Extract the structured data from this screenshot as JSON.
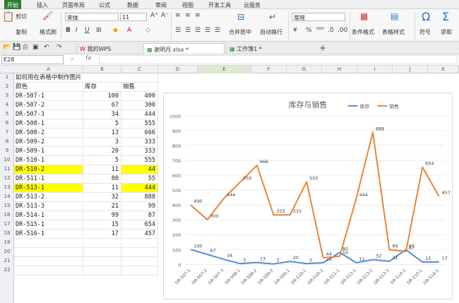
{
  "menu": [
    "开始",
    "插入",
    "页面布局",
    "公式",
    "数据",
    "审阅",
    "视图",
    "开发工具",
    "云服务"
  ],
  "ribbon": {
    "cut": "剪切",
    "copy": "复制",
    "format_painter": "格式刷",
    "font": "宋体",
    "size": "11",
    "merge": "合并居中",
    "wrap": "自动换行",
    "number_format": "常规",
    "cond_format": "条件格式",
    "table_style": "表格样式",
    "symbol": "符号",
    "sum": "求和"
  },
  "tabs": {
    "wps": "我的WPS",
    "file": "谢明月.xlsx *",
    "book": "工作簿1 *"
  },
  "formula_bar": {
    "cell_ref": "E28",
    "fx": "fx",
    "value": ""
  },
  "columns": [
    "A",
    "B",
    "C",
    "D",
    "E",
    "F",
    "G",
    "H",
    "I",
    "J",
    "K"
  ],
  "title_cell": "如何用在表格中制作图片",
  "headers": [
    "颜色",
    "库存",
    "销售"
  ],
  "rows": [
    [
      "DR-507-1",
      "100",
      "400"
    ],
    [
      "DR-507-2",
      "67",
      "300"
    ],
    [
      "DR-507-3",
      "34",
      "444"
    ],
    [
      "DR-508-1",
      "5",
      "555"
    ],
    [
      "DR-508-2",
      "13",
      "666"
    ],
    [
      "DR-509-2",
      "3",
      "333"
    ],
    [
      "DR-509-1",
      "20",
      "333"
    ],
    [
      "DR-510-1",
      "5",
      "555"
    ],
    [
      "DR-510-2",
      "11",
      "44"
    ],
    [
      "DR-511-1",
      "80",
      "55"
    ],
    [
      "DR-513-1",
      "11",
      "444"
    ],
    [
      "DR-513-2",
      "32",
      "888"
    ],
    [
      "DR-513-3",
      "21",
      "99"
    ],
    [
      "DR-514-1",
      "99",
      "87"
    ],
    [
      "DR-515-1",
      "15",
      "654"
    ],
    [
      "DR-516-1",
      "17",
      "457"
    ]
  ],
  "highlight_rows": [
    8,
    10
  ],
  "row_numbers": [
    "1",
    "2",
    "3",
    "4",
    "5",
    "6",
    "7",
    "8",
    "9",
    "10",
    "11",
    "12",
    "13",
    "14",
    "15",
    "16",
    "17",
    "18",
    "19",
    "20",
    "21",
    "22"
  ],
  "colors": {
    "stock": "#4e8fd4",
    "sales": "#e8843a",
    "highlight": "#ffff00"
  },
  "chart_data": {
    "type": "line",
    "title": "库存与销售",
    "categories": [
      "DR-507-1",
      "DR-507-2",
      "DR-507-3",
      "DR-508-1",
      "DR-508-2",
      "DR-509-2",
      "DR-509-1",
      "DR-510-1",
      "DR-510-2",
      "DR-511-1",
      "DR-513-1",
      "DR-513-2",
      "DR-513-3",
      "DR-514-1",
      "DR-515-1",
      "DR-516-1"
    ],
    "series": [
      {
        "name": "库存",
        "values": [
          100,
          67,
          34,
          5,
          13,
          3,
          20,
          5,
          11,
          80,
          11,
          32,
          21,
          99,
          15,
          17
        ]
      },
      {
        "name": "销售",
        "values": [
          400,
          300,
          444,
          555,
          666,
          333,
          333,
          555,
          44,
          55,
          444,
          888,
          99,
          87,
          654,
          457
        ]
      }
    ],
    "ylim": [
      0,
      1000
    ],
    "yticks": [
      "0",
      "100",
      "200",
      "300",
      "400",
      "500",
      "600",
      "700",
      "800",
      "900",
      "1000"
    ],
    "legend": "top-right",
    "grid": true
  }
}
